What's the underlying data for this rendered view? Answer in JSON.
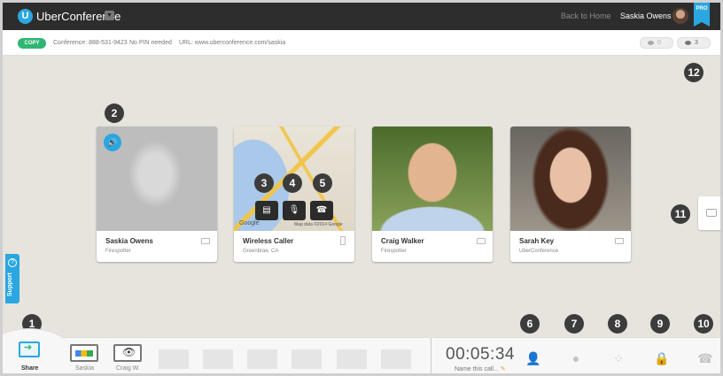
{
  "header": {
    "brand": "UberConference",
    "logo_letter": "U",
    "back_link": "Back to Home",
    "user_name": "Saskia Owens",
    "pro_label": "PRO"
  },
  "infobar": {
    "copy_label": "COPY",
    "conference": "Conference: 888-531-9423",
    "pin": "No PIN needed",
    "url": "URL: www.uberconference.com/saskia",
    "pill_add_count": "0",
    "pill_view_count": "3"
  },
  "participants": [
    {
      "name": "Saskia Owens",
      "sub": "Firespotter",
      "speaking": true
    },
    {
      "name": "Wireless Caller",
      "sub": "Greenbrae, CA",
      "map_brand": "Google",
      "map_credit": "Map data ©2014 Google"
    },
    {
      "name": "Craig Walker",
      "sub": "Firespotter"
    },
    {
      "name": "Sarah Key",
      "sub": "UberConference"
    }
  ],
  "callouts": [
    "1",
    "2",
    "3",
    "4",
    "5",
    "6",
    "7",
    "8",
    "9",
    "10",
    "11",
    "12"
  ],
  "support_label": "Support",
  "bottom": {
    "share_label": "Share",
    "thumb_1_label": "Saskia",
    "thumb_2_label": "Craig W.",
    "timer": "00:05:34",
    "call_name_placeholder": "Name this call..."
  },
  "icons": {
    "speaker": "speaker-icon",
    "add_participant": "add-person-icon",
    "record": "record-icon",
    "dialpad": "dialpad-icon",
    "lock": "lock-icon",
    "hangup": "hangup-icon",
    "chat": "chat-icon"
  },
  "colors": {
    "accent": "#2aa7e0",
    "copy_green": "#2fb673",
    "topbar": "#2d2d2d",
    "stage": "#e6e4dd"
  }
}
